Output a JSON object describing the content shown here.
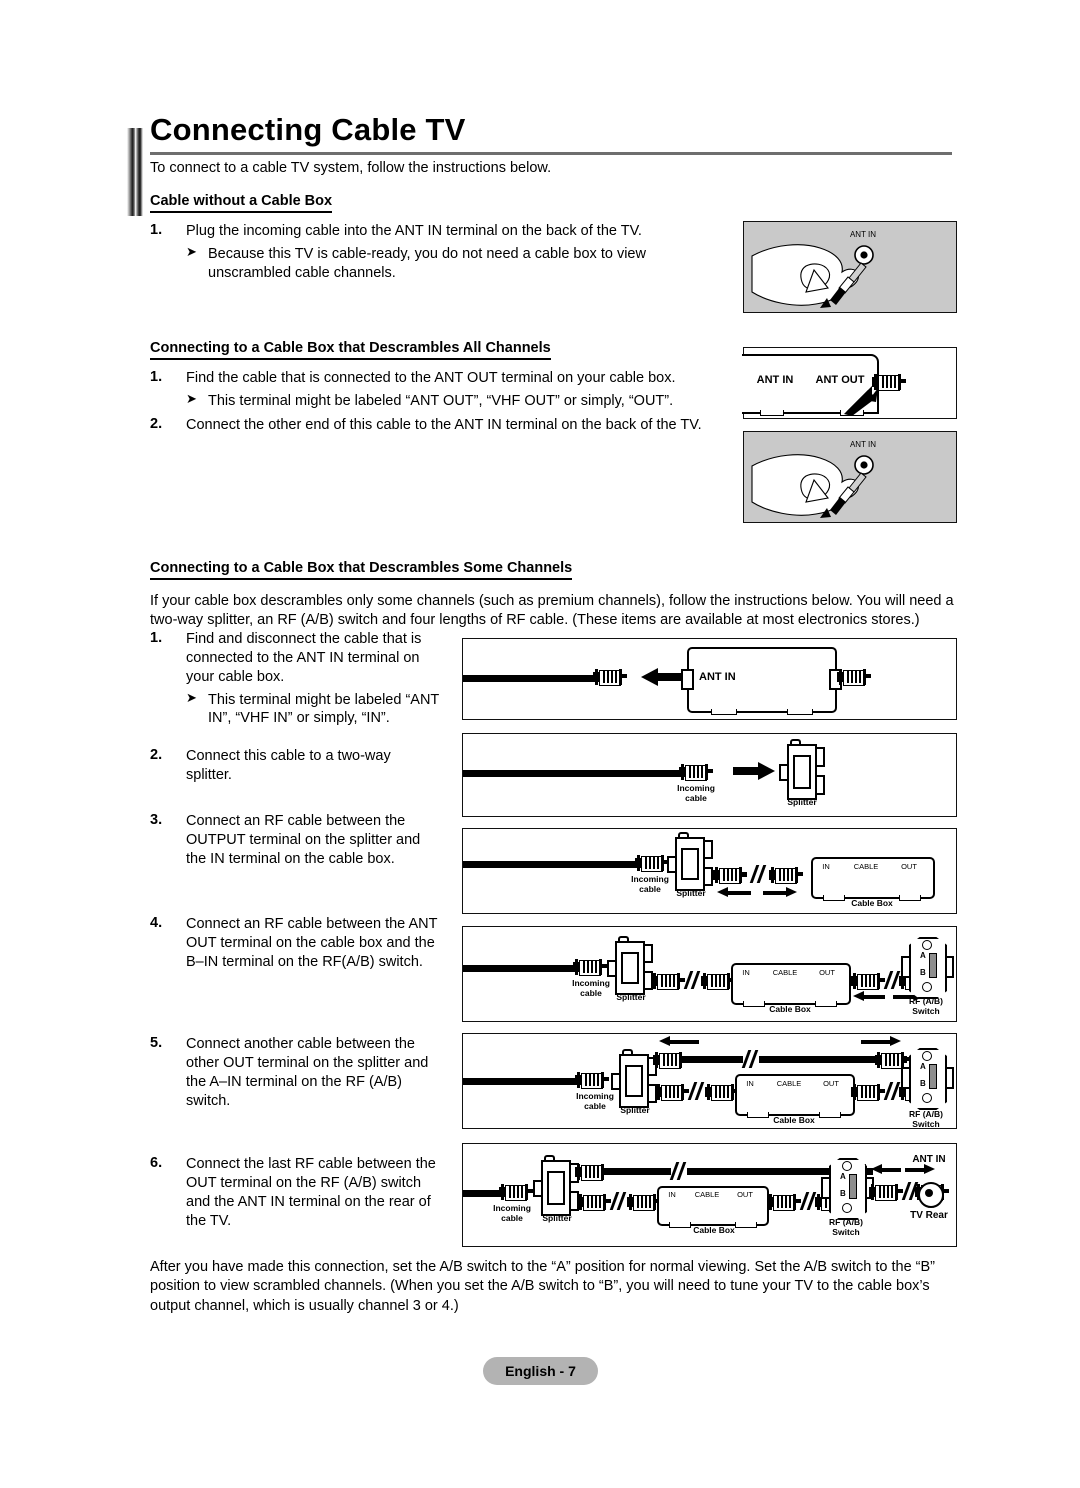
{
  "document": {
    "title": "Connecting Cable TV",
    "intro": "To connect to a cable TV system, follow the instructions below.",
    "footer_label": "English - 7"
  },
  "sections": [
    {
      "heading": "Cable without a Cable Box",
      "steps": [
        {
          "num": "1.",
          "text": "Plug the incoming cable into the ANT IN terminal on the back of the TV.",
          "bullet": "Because this TV is cable-ready, you do not need a cable box to view unscrambled cable channels."
        }
      ]
    },
    {
      "heading": "Connecting to a Cable Box that Descrambles All Channels",
      "steps": [
        {
          "num": "1.",
          "text": "Find the cable that is connected to the ANT OUT terminal on your cable box.",
          "bullet": "This terminal might be labeled “ANT OUT”, “VHF OUT” or simply, “OUT”."
        },
        {
          "num": "2.",
          "text": "Connect the other end of this cable to the ANT IN terminal on the back of the TV."
        }
      ]
    },
    {
      "heading": "Connecting to a Cable Box that Descrambles Some Channels",
      "paragraph": "If your cable box descrambles only some channels (such as premium channels), follow the instructions below. You will need a two-way splitter, an RF (A/B) switch and four lengths of RF cable. (These items are available at most electronics stores.)",
      "steps": [
        {
          "num": "1.",
          "text": "Find and disconnect the cable that is connected to the ANT IN terminal on your cable box.",
          "bullet": "This terminal might be labeled “ANT IN”, “VHF IN” or simply, “IN”."
        },
        {
          "num": "2.",
          "text": "Connect this cable to a two-way splitter."
        },
        {
          "num": "3.",
          "text": "Connect an RF cable between the OUTPUT terminal on the splitter and the IN terminal on the cable box."
        },
        {
          "num": "4.",
          "text": "Connect an RF cable between the ANT OUT terminal on the cable box and the B–IN terminal on the RF(A/B) switch."
        },
        {
          "num": "5.",
          "text": "Connect another cable between the other OUT terminal on the splitter and the A–IN terminal on the RF (A/B) switch."
        },
        {
          "num": "6.",
          "text": "Connect the last RF cable between the OUT terminal on the RF (A/B) switch and the ANT IN terminal on the rear of the TV."
        }
      ]
    }
  ],
  "closing_paragraph": "After you have made this connection, set the A/B switch to the “A” position for normal viewing. Set the A/B switch to the “B” position to view scrambled channels. (When you set the A/B switch to “B”, you will need to tune your TV to the cable box’s output channel, which is usually channel 3 or 4.)",
  "figures": {
    "hand_ant_in_top": {
      "label": "ANT IN"
    },
    "cable_box_rear": {
      "ant_in": "ANT IN",
      "ant_out": "ANT OUT"
    },
    "hand_ant_in_second": {
      "label": "ANT IN"
    },
    "panel1": {
      "ant_in": "ANT IN"
    },
    "panel2": {
      "incoming_cable": "Incoming\ncable",
      "splitter": "Splitter"
    },
    "panel3": {
      "incoming_cable": "Incoming\ncable",
      "splitter": "Splitter",
      "cable_box": "Cable Box",
      "box_ports": [
        "IN",
        "CABLE",
        "OUT"
      ]
    },
    "panel4": {
      "incoming_cable": "Incoming\ncable",
      "splitter": "Splitter",
      "cable_box": "Cable Box",
      "box_ports": [
        "IN",
        "CABLE",
        "OUT"
      ],
      "rf_switch": "RF (A/B)\nSwitch",
      "switch_positions": [
        "A",
        "B"
      ]
    },
    "panel5": {
      "incoming_cable": "Incoming\ncable",
      "splitter": "Splitter",
      "cable_box": "Cable Box",
      "box_ports": [
        "IN",
        "CABLE",
        "OUT"
      ],
      "rf_switch": "RF (A/B)\nSwitch",
      "switch_positions": [
        "A",
        "B"
      ]
    },
    "panel6": {
      "incoming_cable": "Incoming\ncable",
      "splitter": "Splitter",
      "cable_box": "Cable Box",
      "box_ports": [
        "IN",
        "CABLE",
        "OUT"
      ],
      "rf_switch": "RF (A/B)\nSwitch",
      "switch_positions": [
        "A",
        "B"
      ],
      "ant_in": "ANT IN",
      "tv_rear": "TV Rear"
    }
  },
  "colors": {
    "panel_gray": "#c9c9c9",
    "footer_gray": "#b3b3b3",
    "rule_gray": "#6e6e6e",
    "ink": "#000000"
  }
}
